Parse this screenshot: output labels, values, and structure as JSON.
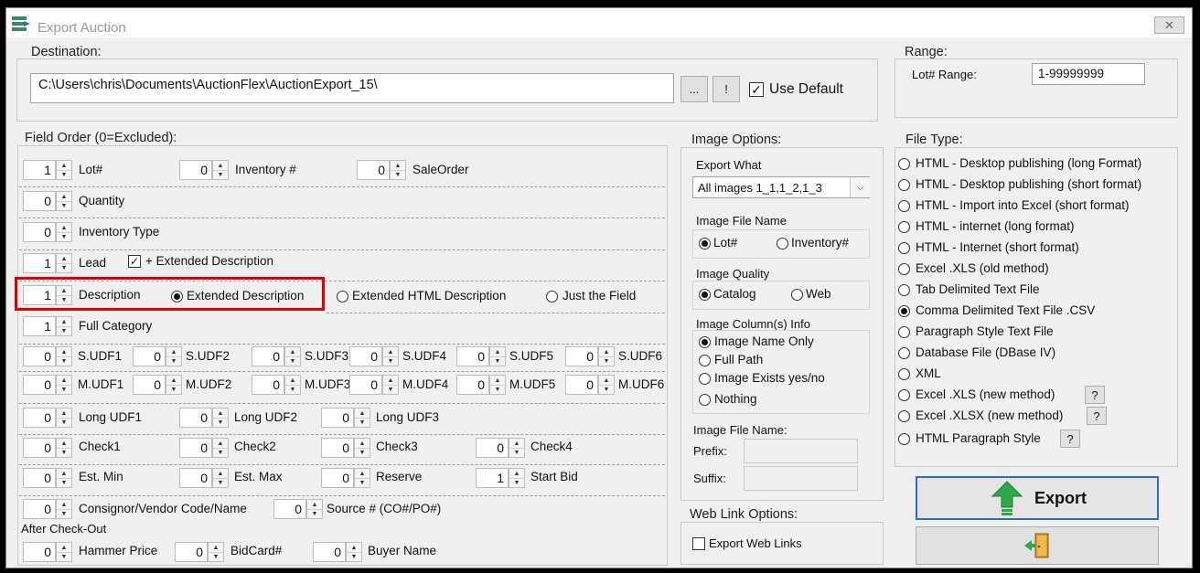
{
  "window": {
    "title": "Export Auction",
    "close_icon": "✕"
  },
  "destination": {
    "label": "Destination:",
    "path": "C:\\Users\\chris\\Documents\\AuctionFlex\\AuctionExport_15\\",
    "browse_label": "...",
    "info_label": "!",
    "use_default_label": "Use Default",
    "use_default_checked": true
  },
  "range": {
    "label": "Range:",
    "lot_range_label": "Lot# Range:",
    "lot_range_value": "1-99999999"
  },
  "field_order": {
    "label": "Field Order (0=Excluded):",
    "lot": {
      "label": "Lot#",
      "value": "1"
    },
    "inventory": {
      "label": "Inventory #",
      "value": "0"
    },
    "saleorder": {
      "label": "SaleOrder",
      "value": "0"
    },
    "quantity": {
      "label": "Quantity",
      "value": "0"
    },
    "inventory_type": {
      "label": "Inventory Type",
      "value": "0"
    },
    "lead": {
      "label": "Lead",
      "value": "1"
    },
    "lead_extended_label": "+ Extended Description",
    "lead_extended_checked": true,
    "description": {
      "label": "Description",
      "value": "1"
    },
    "desc_options": [
      "Extended Description",
      "Extended HTML Description",
      "Just the Field"
    ],
    "desc_selected": 0,
    "full_category": {
      "label": "Full Category",
      "value": "1"
    },
    "s_udf": [
      {
        "label": "S.UDF1",
        "value": "0"
      },
      {
        "label": "S.UDF2",
        "value": "0"
      },
      {
        "label": "S.UDF3",
        "value": "0"
      },
      {
        "label": "S.UDF4",
        "value": "0"
      },
      {
        "label": "S.UDF5",
        "value": "0"
      },
      {
        "label": "S.UDF6",
        "value": "0"
      }
    ],
    "m_udf": [
      {
        "label": "M.UDF1",
        "value": "0"
      },
      {
        "label": "M.UDF2",
        "value": "0"
      },
      {
        "label": "M.UDF3",
        "value": "0"
      },
      {
        "label": "M.UDF4",
        "value": "0"
      },
      {
        "label": "M.UDF5",
        "value": "0"
      },
      {
        "label": "M.UDF6",
        "value": "0"
      }
    ],
    "long_udf": [
      {
        "label": "Long UDF1",
        "value": "0"
      },
      {
        "label": "Long UDF2",
        "value": "0"
      },
      {
        "label": "Long UDF3",
        "value": "0"
      }
    ],
    "checks": [
      {
        "label": "Check1",
        "value": "0"
      },
      {
        "label": "Check2",
        "value": "0"
      },
      {
        "label": "Check3",
        "value": "0"
      },
      {
        "label": "Check4",
        "value": "0"
      }
    ],
    "est_min": {
      "label": "Est. Min",
      "value": "0"
    },
    "est_max": {
      "label": "Est. Max",
      "value": "0"
    },
    "reserve": {
      "label": "Reserve",
      "value": "0"
    },
    "start_bid": {
      "label": "Start Bid",
      "value": "1"
    },
    "consignor": {
      "label": "Consignor/Vendor Code/Name",
      "value": "0"
    },
    "source": {
      "label": "Source # (CO#/PO#)",
      "value": "0"
    },
    "after_checkout_label": "After Check-Out",
    "hammer": {
      "label": "Hammer Price",
      "value": "0"
    },
    "bidcard": {
      "label": "BidCard#",
      "value": "0"
    },
    "buyer": {
      "label": "Buyer Name",
      "value": "0"
    }
  },
  "image_options": {
    "label": "Image Options:",
    "export_what_label": "Export What",
    "export_what_value": "All images 1_1,1_2,1_3",
    "file_name_label": "Image File Name",
    "file_name_options": [
      "Lot#",
      "Inventory#"
    ],
    "file_name_selected": 0,
    "quality_label": "Image Quality",
    "quality_options": [
      "Catalog",
      "Web"
    ],
    "quality_selected": 0,
    "column_label": "Image Column(s) Info",
    "column_options": [
      "Image Name Only",
      "Full Path",
      "Image Exists yes/no",
      "Nothing"
    ],
    "column_selected": 0,
    "file_name2_label": "Image File Name:",
    "prefix_label": "Prefix:",
    "suffix_label": "Suffix:",
    "prefix_value": "",
    "suffix_value": ""
  },
  "web_link": {
    "label": "Web Link Options:",
    "export_label": "Export Web Links",
    "export_checked": false
  },
  "file_type": {
    "label": "File Type:",
    "options": [
      "HTML - Desktop publishing  (long Format)",
      "HTML - Desktop publishing (short format)",
      "HTML - Import into Excel (short format)",
      "HTML - internet (long format)",
      "HTML - Internet (short format)",
      "Excel .XLS (old method)",
      "Tab Delimited Text File",
      "Comma Delimited Text File  .CSV",
      "Paragraph Style Text File",
      "Database File (DBase IV)",
      "XML",
      "Excel .XLS (new method)",
      "Excel .XLSX (new method)",
      "HTML Paragraph Style"
    ],
    "selected": 7,
    "help_label": "?"
  },
  "export_button": {
    "label": "Export"
  },
  "colors": {
    "highlight": "#e00000",
    "export_border": "#2d6bd6",
    "arrow_green": "#2fa84a"
  }
}
